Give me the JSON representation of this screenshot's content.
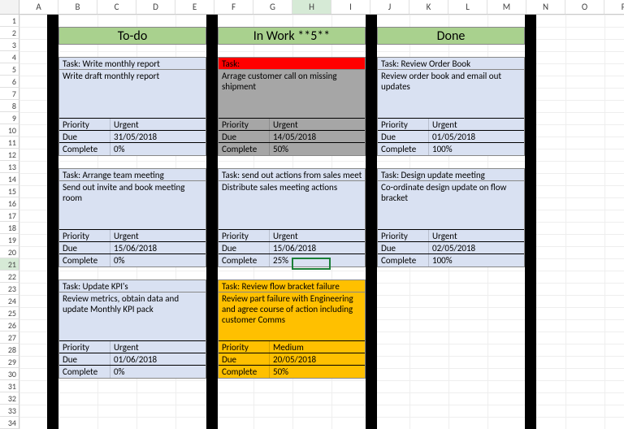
{
  "columns": [
    "A",
    "B",
    "C",
    "D",
    "E",
    "F",
    "G",
    "H",
    "I",
    "J",
    "K",
    "L",
    "M",
    "N",
    "O",
    "P"
  ],
  "selected_col": "H",
  "selected_row": 21,
  "kanban": {
    "todo": {
      "header": "To-do",
      "cards": [
        {
          "title_label": "Task:",
          "title": "Write monthly report",
          "desc": "Write draft monthly report",
          "priority_label": "Priority",
          "priority": "Urgent",
          "due_label": "Due",
          "due": "31/05/2018",
          "complete_label": "Complete",
          "complete": "0%"
        },
        {
          "title_label": "Task:",
          "title": "Arrange team meeting",
          "desc": "Send out invite and book meeting room",
          "priority_label": "Priority",
          "priority": "Urgent",
          "due_label": "Due",
          "due": "15/06/2018",
          "complete_label": "Complete",
          "complete": "0%"
        },
        {
          "title_label": "Task:",
          "title": "Update KPI's",
          "desc": "Review metrics, obtain data and update Monthly KPI pack",
          "priority_label": "Priority",
          "priority": "Urgent",
          "due_label": "Due",
          "due": "01/06/2018",
          "complete_label": "Complete",
          "complete": "0%"
        }
      ]
    },
    "inwork": {
      "header": "In Work **5**",
      "cards": [
        {
          "title_label": "Task:",
          "title": "",
          "desc": "Arrage customer call on missing shipment",
          "priority_label": "Priority",
          "priority": "Urgent",
          "due_label": "Due",
          "due": "14/05/2018",
          "complete_label": "Complete",
          "complete": "50%",
          "style": "red"
        },
        {
          "title_label": "Task:",
          "title": "send out actions from sales meet",
          "desc": "Distribute sales meeting actions",
          "priority_label": "Priority",
          "priority": "Urgent",
          "due_label": "Due",
          "due": "15/06/2018",
          "complete_label": "Complete",
          "complete": "25%"
        },
        {
          "title_label": "Task:",
          "title": "Review flow bracket failure",
          "desc": "Review part failure with Engineering and agree course of action including customer Comms",
          "priority_label": "Priority",
          "priority": "Medium",
          "due_label": "Due",
          "due": "20/05/2018",
          "complete_label": "Complete",
          "complete": "50%",
          "style": "orange"
        }
      ]
    },
    "done": {
      "header": "Done",
      "cards": [
        {
          "title_label": "Task:",
          "title": "Review Order Book",
          "desc": "Review order book and email out updates",
          "priority_label": "Priority",
          "priority": "Urgent",
          "due_label": "Due",
          "due": "01/05/2018",
          "complete_label": "Complete",
          "complete": "100%"
        },
        {
          "title_label": "Task:",
          "title": "Design update meeting",
          "desc": "Co-ordinate design update on flow bracket",
          "priority_label": "Priority",
          "priority": "Urgent",
          "due_label": "Due",
          "due": "02/05/2018",
          "complete_label": "Complete",
          "complete": "100%"
        }
      ]
    }
  }
}
